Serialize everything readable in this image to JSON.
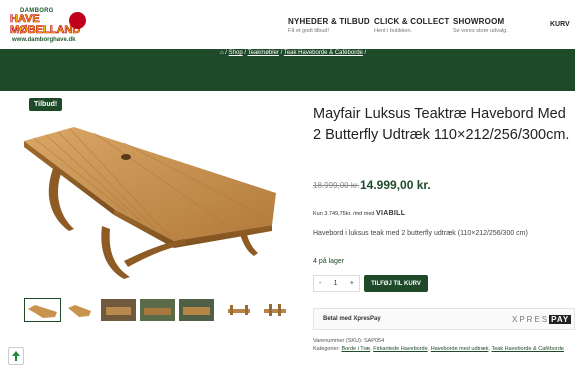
{
  "header": {
    "logo": {
      "line1": "DAMBORG",
      "line2": "HAVE",
      "line3": "MØBELLAND",
      "url": "www.damborghave.dk"
    },
    "nav": [
      {
        "title": "NYHEDER & TILBUD",
        "sub": "Få et godt tilbud!"
      },
      {
        "title": "CLICK & COLLECT",
        "sub": "Hent i butikken."
      },
      {
        "title": "SHOWROOM",
        "sub": "Se vores store udvalg."
      }
    ],
    "cart_label": "KURV"
  },
  "breadcrumbs": {
    "sep1": "/",
    "item1": "Shop",
    "sep2": "/",
    "item2": "Teakmøbler",
    "sep3": "/",
    "item3": "Teak Haveborde & Caféborde",
    "sep4": "/"
  },
  "product": {
    "badge": "Tilbud!",
    "title": "Mayfair Luksus Teaktræ Havebord Med 2 Butterfly Udtræk 110×212/256/300cm.",
    "old_price": "18.999,00 kr.",
    "price": "14.999,00 kr.",
    "viabill_text": "Kun 3.749,75kr. /md med",
    "viabill_brand": "VIABILL",
    "description": "Havebord i luksus teak med 2 butterfly udtræk (110×212/256/300 cm)",
    "stock": "4 på lager",
    "quantity": "1",
    "qty_minus": "-",
    "qty_plus": "+",
    "add_to_cart": "TILFØJ TIL KURV",
    "xpres_label": "Betal med XpresPay",
    "xpres_brand_a": "XPRES",
    "xpres_brand_b": "PAY",
    "sku_label": "Varenummer (SKU):",
    "sku": "SAP054",
    "cat_label": "Kategorier:",
    "categories": [
      "Borde i Træ",
      "Firkantede Haveborde",
      "Haveborde med udtræk",
      "Teak Haveborde & Caféborde"
    ]
  },
  "colors": {
    "brand_green": "#1f4a2a",
    "logo_yellow": "#f7c600",
    "logo_red": "#c0001a"
  }
}
